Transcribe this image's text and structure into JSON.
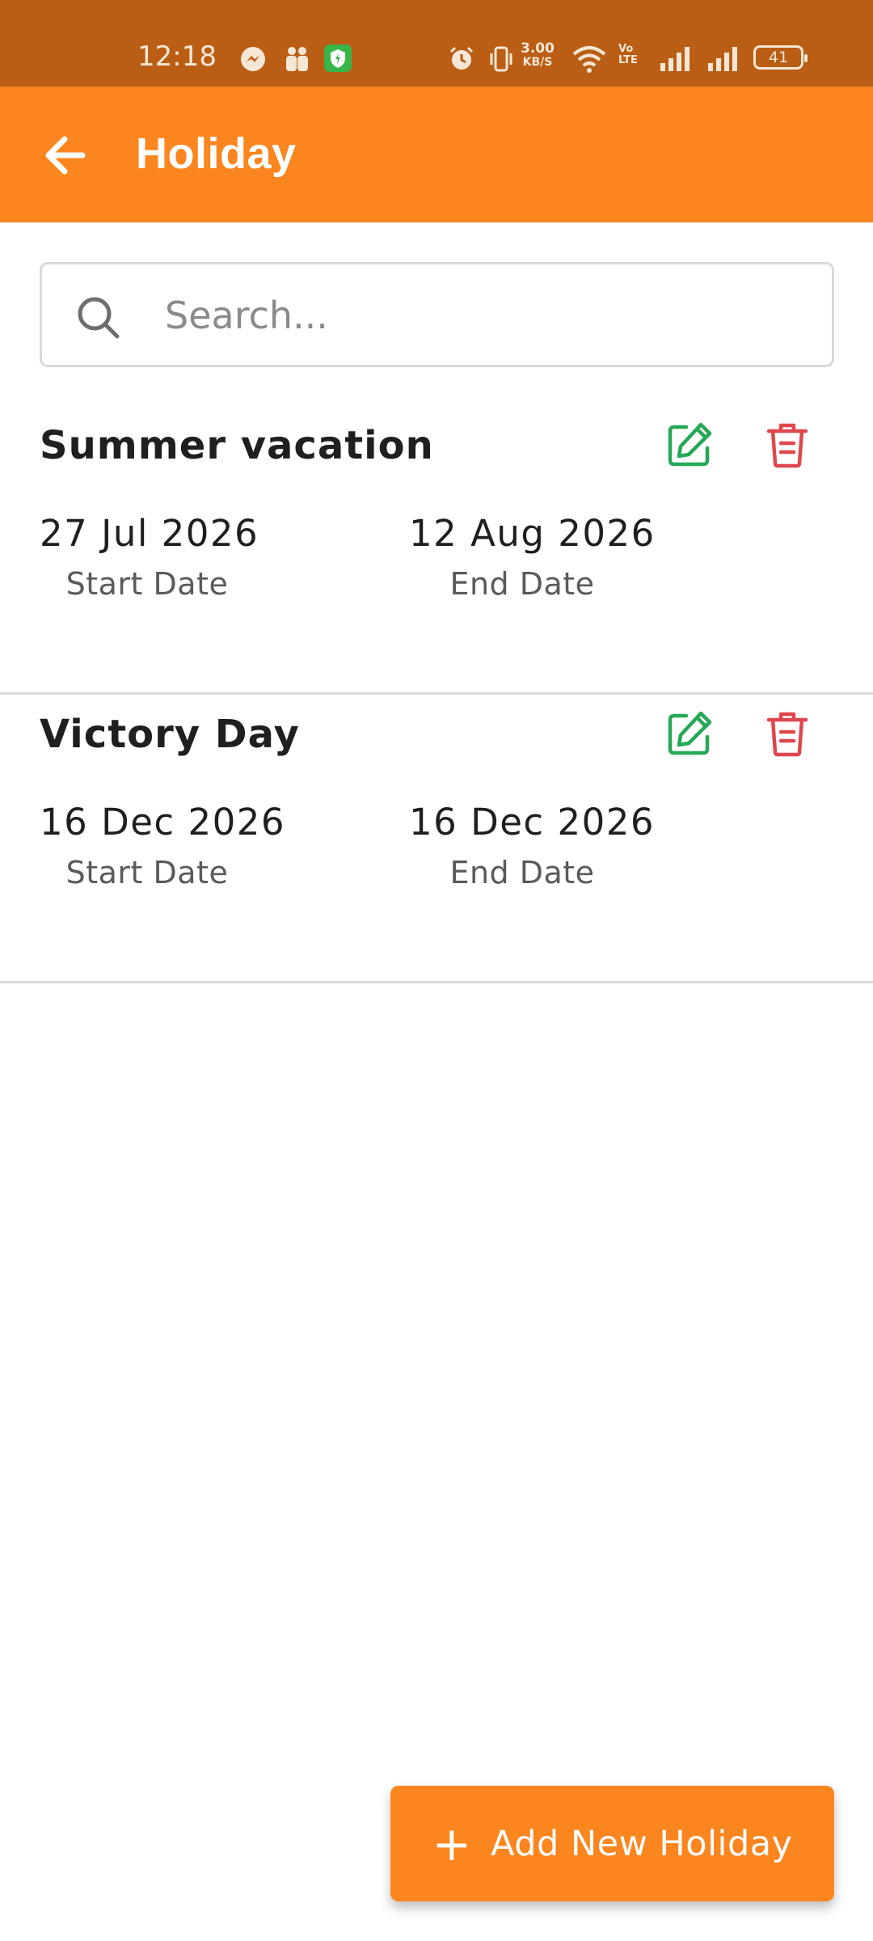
{
  "status_bar": {
    "time": "12:18",
    "net_speed_value": "3.00",
    "net_speed_unit": "KB/S",
    "volte_label": "Vo LTE",
    "battery": "41"
  },
  "app_bar": {
    "title": "Holiday",
    "back_icon": "arrow-left-icon",
    "background_color": "#fb851e"
  },
  "search": {
    "placeholder": "Search...",
    "value": ""
  },
  "holidays": [
    {
      "name": "Summer vacation",
      "start_date": "27 Jul 2026",
      "start_label": "Start Date",
      "end_date": "12 Aug 2026",
      "end_label": "End Date"
    },
    {
      "name": "Victory Day",
      "start_date": "16 Dec 2026",
      "start_label": "Start Date",
      "end_date": "16 Dec 2026",
      "end_label": "End Date"
    }
  ],
  "actions": {
    "edit_icon": "edit-icon",
    "edit_color": "#27a857",
    "delete_icon": "trash-icon",
    "delete_color": "#e0474c"
  },
  "fab": {
    "plus": "+",
    "label": "Add New Holiday"
  }
}
